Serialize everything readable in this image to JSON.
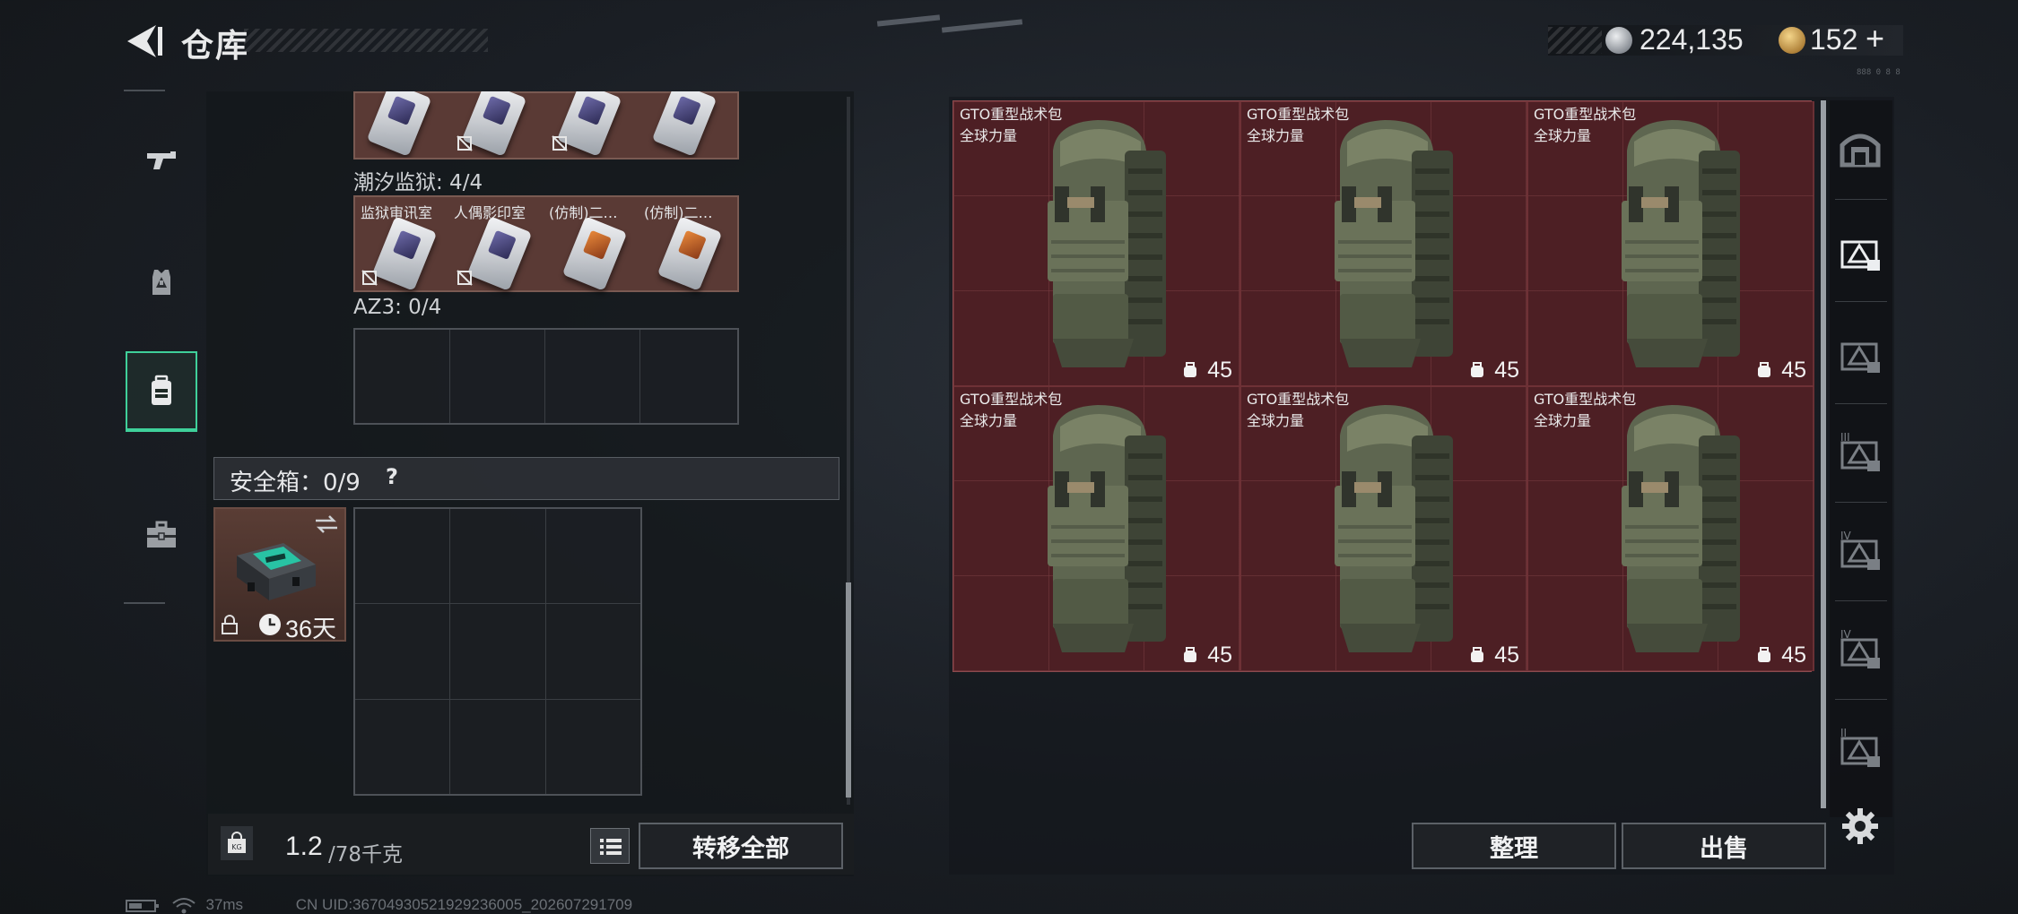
{
  "header": {
    "title": "仓库",
    "currency_silver": "224,135",
    "currency_gold": "152",
    "add_label": "+",
    "code": "888 0 8 8"
  },
  "left_nav": {
    "items": [
      "weapons",
      "armor",
      "backpack",
      "toolbox"
    ],
    "active": "backpack"
  },
  "inventory": {
    "top_row_cards": [
      {
        "label": "",
        "locked": false
      },
      {
        "label": "",
        "locked": true
      },
      {
        "label": "",
        "locked": true
      },
      {
        "label": "",
        "locked": false
      }
    ],
    "section1_label": "潮汐监狱: 4/4",
    "section1_cards": [
      {
        "label": "监狱审讯室",
        "locked": true,
        "style": "purple"
      },
      {
        "label": "人偶影印室",
        "locked": true,
        "style": "purple"
      },
      {
        "label": "(仿制)二…",
        "locked": false,
        "style": "orange"
      },
      {
        "label": "(仿制)二…",
        "locked": false,
        "style": "orange"
      }
    ],
    "section2_label": "AZ3: 0/4",
    "safe_label": "安全箱：0/9",
    "help": "?",
    "safe_days": "36天"
  },
  "weight": {
    "current": "1.2",
    "max": "/78千克"
  },
  "buttons": {
    "transfer_all": "转移全部",
    "sort": "整理",
    "sell": "出售"
  },
  "stash": {
    "items": [
      {
        "name": "GTO重型战术包",
        "tag": "全球力量",
        "count": "45"
      },
      {
        "name": "GTO重型战术包",
        "tag": "全球力量",
        "count": "45"
      },
      {
        "name": "GTO重型战术包",
        "tag": "全球力量",
        "count": "45"
      },
      {
        "name": "GTO重型战术包",
        "tag": "全球力量",
        "count": "45"
      },
      {
        "name": "GTO重型战术包",
        "tag": "全球力量",
        "count": "45"
      },
      {
        "name": "GTO重型战术包",
        "tag": "全球力量",
        "count": "45"
      }
    ],
    "tabs": [
      "stash-tab-1",
      "stash-tab-2",
      "stash-tab-3",
      "stash-tab-4",
      "stash-tab-5",
      "stash-tab-6",
      "stash-tab-7"
    ],
    "active_tab": 1
  },
  "status": {
    "ping": "37ms",
    "uid": "CN UID:367049305219292360​05_202607291709"
  },
  "colors": {
    "accent": "#3fd09a",
    "stash_bg": "#4d1f24",
    "card_brown": "#5a3a35"
  }
}
